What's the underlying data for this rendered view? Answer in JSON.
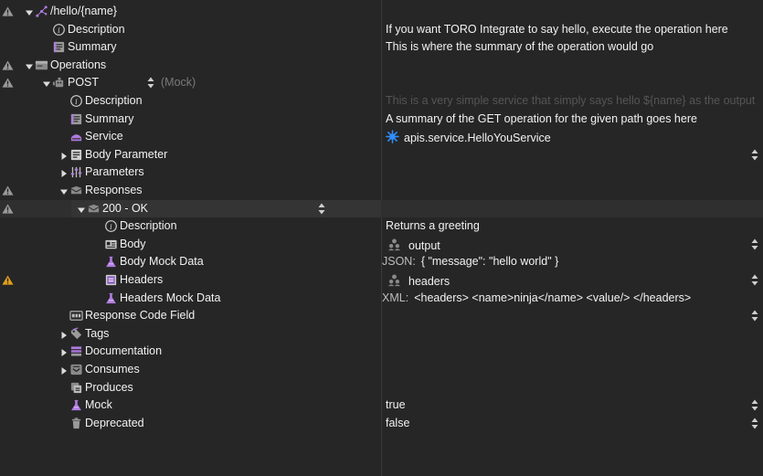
{
  "colors": {
    "background": "#262626",
    "highlight_row": "#2f2f2f",
    "text": "#f2f2f2",
    "muted_text": "#7a7a7a",
    "placeholder": "#555555",
    "warning_orange": "#e0a11a",
    "warning_gray": "#9a9a9a",
    "purple_icon": "#b07be0",
    "service_blue": "#2f8fff"
  },
  "rows": [
    {
      "label": "/hello/{name}",
      "icon": "tree-graph-icon",
      "twisty": "expanded",
      "warning": "gray",
      "value": ""
    },
    {
      "label": "Description",
      "icon": "info-icon",
      "twisty": "",
      "warning": "",
      "value": "If you want TORO Integrate to say hello, execute the operation here"
    },
    {
      "label": "Summary",
      "icon": "document-icon",
      "twisty": "",
      "warning": "",
      "value": "This is where the summary of the operation would go"
    },
    {
      "label": "Operations",
      "icon": "operations-box-icon",
      "twisty": "expanded",
      "warning": "gray",
      "value": ""
    },
    {
      "label": "POST",
      "icon": "robot-icon",
      "twisty": "expanded",
      "warning": "gray",
      "stepper": true,
      "suffix": "(Mock)",
      "value": ""
    },
    {
      "label": "Description",
      "icon": "info-icon",
      "twisty": "",
      "warning": "",
      "value": "This is a very simple service that simply says hello ${name} as the output"
    },
    {
      "label": "Summary",
      "icon": "document-icon",
      "twisty": "",
      "warning": "",
      "value": "A summary of the GET operation for the given path goes here"
    },
    {
      "label": "Service",
      "icon": "service-icon",
      "twisty": "",
      "warning": "",
      "value": "apis.service.HelloYouService",
      "value_icon": "service-splash-icon"
    },
    {
      "label": "Body Parameter",
      "icon": "body-parameter-icon",
      "twisty": "collapsed",
      "warning": "",
      "value": "",
      "rstep": true
    },
    {
      "label": "Parameters",
      "icon": "parameters-icon",
      "twisty": "collapsed",
      "warning": "",
      "value": ""
    },
    {
      "label": "Responses",
      "icon": "envelope-icon",
      "twisty": "expanded",
      "warning": "gray",
      "value": ""
    },
    {
      "label": "200 - OK",
      "icon": "envelope-icon",
      "twisty": "expanded",
      "warning": "gray",
      "stepper": true,
      "highlight": true,
      "value": ""
    },
    {
      "label": "Description",
      "icon": "info-icon",
      "twisty": "",
      "warning": "",
      "value": "Returns a greeting"
    },
    {
      "label": "Body",
      "icon": "card-icon",
      "twisty": "",
      "warning": "",
      "value": "output",
      "value_icon": "users-icon",
      "rstep": true
    },
    {
      "label": "Body Mock Data",
      "icon": "flask-icon",
      "twisty": "",
      "warning": "",
      "value": "{ \"message\": \"hello world\" }",
      "value_prefix": "JSON:"
    },
    {
      "label": "Headers",
      "icon": "headers-icon",
      "twisty": "",
      "warning": "orange",
      "value": "headers",
      "value_icon": "users-icon",
      "rstep": true
    },
    {
      "label": "Headers Mock Data",
      "icon": "flask-icon",
      "twisty": "",
      "warning": "",
      "value": "<headers> <name>ninja</name> <value/> </headers>",
      "value_prefix": "XML:"
    },
    {
      "label": "Response Code Field",
      "icon": "code-field-icon",
      "twisty": "",
      "warning": "",
      "value": "",
      "rstep": true
    },
    {
      "label": "Tags",
      "icon": "tags-icon",
      "twisty": "collapsed",
      "warning": "",
      "value": ""
    },
    {
      "label": "Documentation",
      "icon": "documentation-icon",
      "twisty": "collapsed",
      "warning": "",
      "value": ""
    },
    {
      "label": "Consumes",
      "icon": "consumes-icon",
      "twisty": "collapsed",
      "warning": "",
      "value": ""
    },
    {
      "label": "Produces",
      "icon": "produces-icon",
      "twisty": "",
      "warning": "",
      "value": ""
    },
    {
      "label": "Mock",
      "icon": "flask-icon",
      "twisty": "",
      "warning": "",
      "value": "true",
      "rstep": true
    },
    {
      "label": "Deprecated",
      "icon": "trash-icon",
      "twisty": "",
      "warning": "",
      "value": "false",
      "rstep": true
    }
  ]
}
